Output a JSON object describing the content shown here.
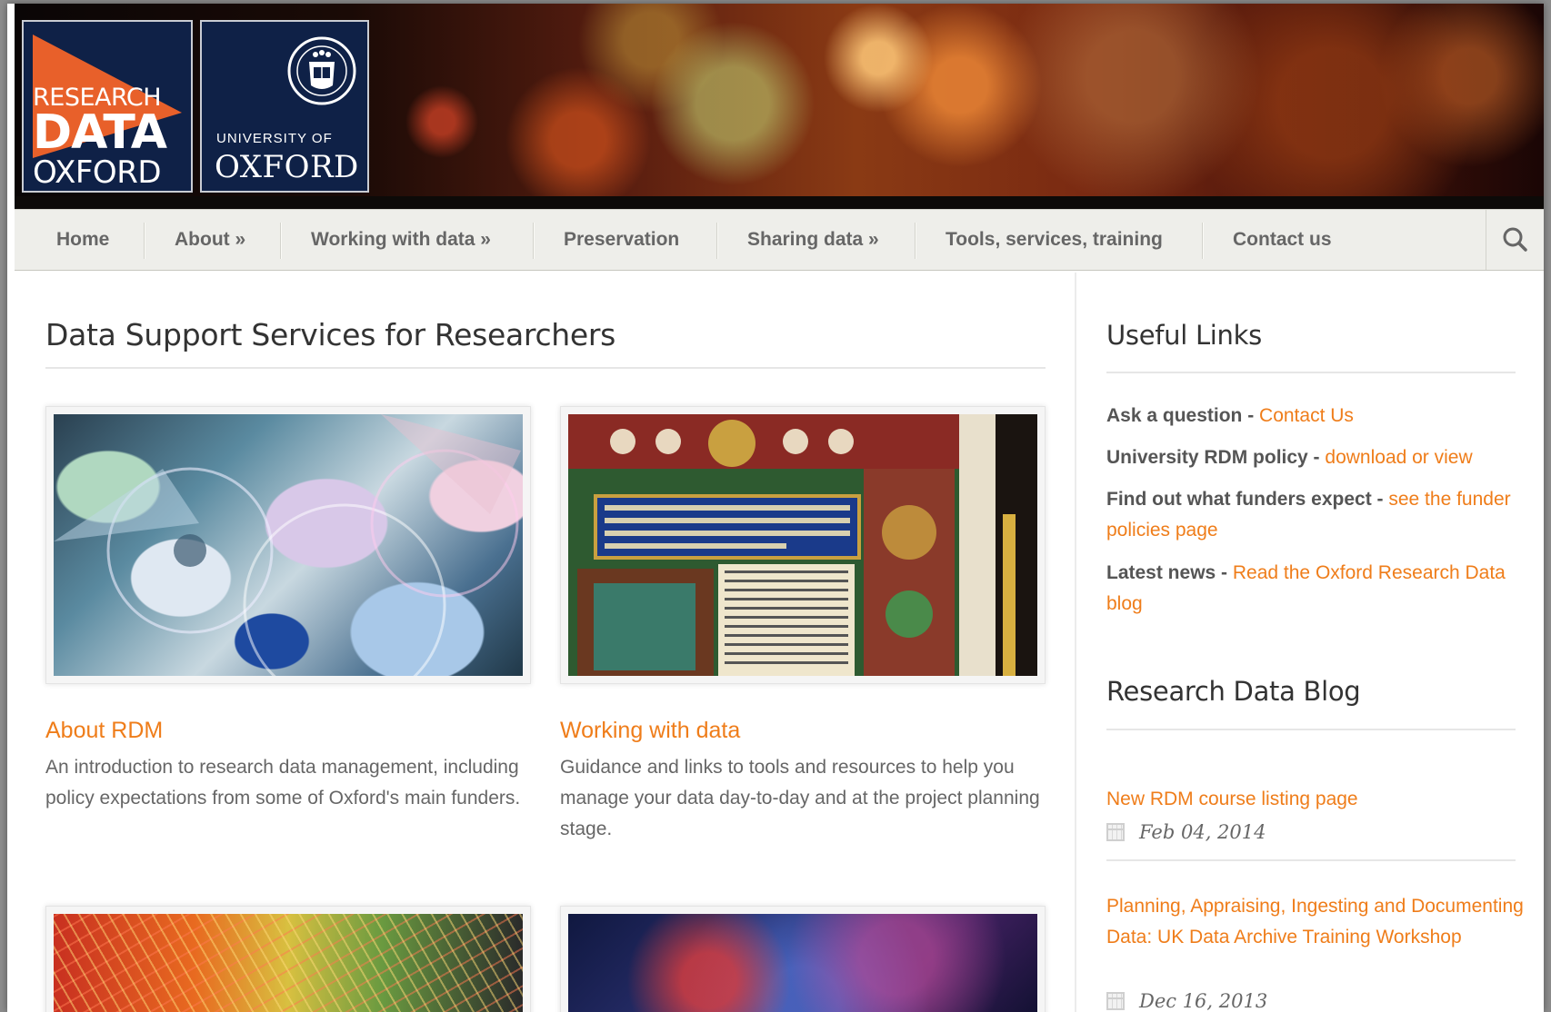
{
  "header": {
    "logo_rdo": {
      "line1": "RESEARCH",
      "line2": "DATA",
      "line3": "OXFORD"
    },
    "logo_university": {
      "line1": "UNIVERSITY OF",
      "line2": "OXFORD"
    }
  },
  "nav": {
    "items": [
      {
        "label": "Home"
      },
      {
        "label": "About »"
      },
      {
        "label": "Working with data »"
      },
      {
        "label": "Preservation"
      },
      {
        "label": "Sharing data »"
      },
      {
        "label": "Tools, services, training"
      },
      {
        "label": "Contact us"
      }
    ],
    "search_icon": "search-icon"
  },
  "main": {
    "title": "Data Support Services for Researchers",
    "cards": [
      {
        "title": "About RDM",
        "description": "An introduction to research data management, including policy expectations from some of Oxford's main funders."
      },
      {
        "title": "Working with data",
        "description": "Guidance and links to tools and resources to help you manage your data day-to-day and at the project planning stage."
      }
    ]
  },
  "sidebar": {
    "useful_links": {
      "heading": "Useful Links",
      "items": [
        {
          "label": "Ask a question - ",
          "link": "Contact Us"
        },
        {
          "label": "University RDM policy - ",
          "link": "download or view"
        },
        {
          "label": "Find out what funders expect - ",
          "link": "see the funder policies page"
        },
        {
          "label": "Latest news - ",
          "link": "Read the Oxford Research Data blog"
        }
      ]
    },
    "blog": {
      "heading": "Research Data Blog",
      "posts": [
        {
          "title": "New RDM course listing page",
          "date": "Feb 04, 2014"
        },
        {
          "title": "Planning, Appraising, Ingesting and Documenting Data: UK Data Archive Training Workshop",
          "date": "Dec 16, 2013"
        }
      ]
    }
  },
  "colors": {
    "accent": "#ef7d1a",
    "navy": "#0f2147",
    "rdo_orange": "#e8602a"
  }
}
